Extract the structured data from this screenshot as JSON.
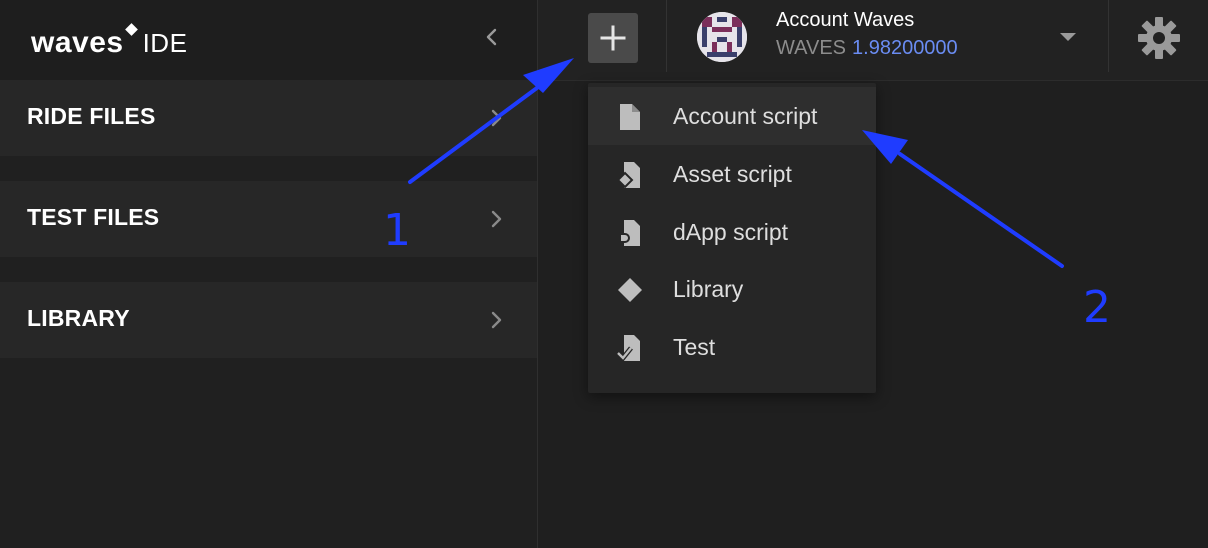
{
  "app": {
    "logo_word": "waves",
    "logo_suffix": "IDE"
  },
  "sidebar": {
    "sections": [
      {
        "label": "RIDE FILES"
      },
      {
        "label": "TEST FILES"
      },
      {
        "label": "LIBRARY"
      }
    ]
  },
  "account": {
    "name": "Account Waves",
    "currency": "WAVES",
    "balance": "1.98200000"
  },
  "new_file_menu": {
    "items": [
      {
        "label": "Account script",
        "icon": "file-icon",
        "active": true
      },
      {
        "label": "Asset script",
        "icon": "asset-script-icon"
      },
      {
        "label": "dApp script",
        "icon": "dapp-script-icon"
      },
      {
        "label": "Library",
        "icon": "diamond-icon"
      },
      {
        "label": "Test",
        "icon": "test-script-icon"
      }
    ]
  },
  "annotations": {
    "marker_1": "1",
    "marker_2": "2",
    "arrow_color": "#1f3cff"
  },
  "colors": {
    "accent_balance": "#6a8cf2",
    "background": "#1f1f1f"
  }
}
